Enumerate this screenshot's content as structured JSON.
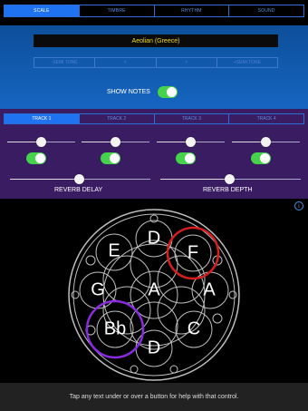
{
  "tabs": [
    {
      "label": "SCALE",
      "active": true
    },
    {
      "label": "TIMBRE",
      "active": false
    },
    {
      "label": "RHYTHM",
      "active": false
    },
    {
      "label": "SOUND",
      "active": false
    }
  ],
  "scale": {
    "name": "Aeolian (Greece)",
    "semitone_buttons": [
      "-SEMI TONE",
      "<",
      ">",
      "+SEMI TONE"
    ]
  },
  "show_notes": {
    "label": "SHOW NOTES",
    "on": true
  },
  "tracks": [
    {
      "label": "TRACK 1",
      "active": true
    },
    {
      "label": "TRACK 2",
      "active": false
    },
    {
      "label": "TRACK 3",
      "active": false
    },
    {
      "label": "TRACK 4",
      "active": false
    }
  ],
  "track_sliders": [
    0.5,
    0.5,
    0.5,
    0.5
  ],
  "track_toggles": [
    true,
    true,
    true,
    true
  ],
  "reverb": {
    "delay_label": "REVERB DELAY",
    "delay_value": 0.45,
    "depth_label": "REVERB DEPTH",
    "depth_value": 0.45
  },
  "notes": [
    "D",
    "F",
    "A",
    "C",
    "D",
    "Bb",
    "G",
    "E",
    "A"
  ],
  "colors": {
    "accent": "#1f73f0",
    "toggle_on": "#46d24a",
    "scale_text": "#f4dd1c",
    "ring_red": "#d91e1e",
    "ring_purple": "#8a2be2"
  },
  "help_text": "Tap any text under or over a button for help with that control."
}
